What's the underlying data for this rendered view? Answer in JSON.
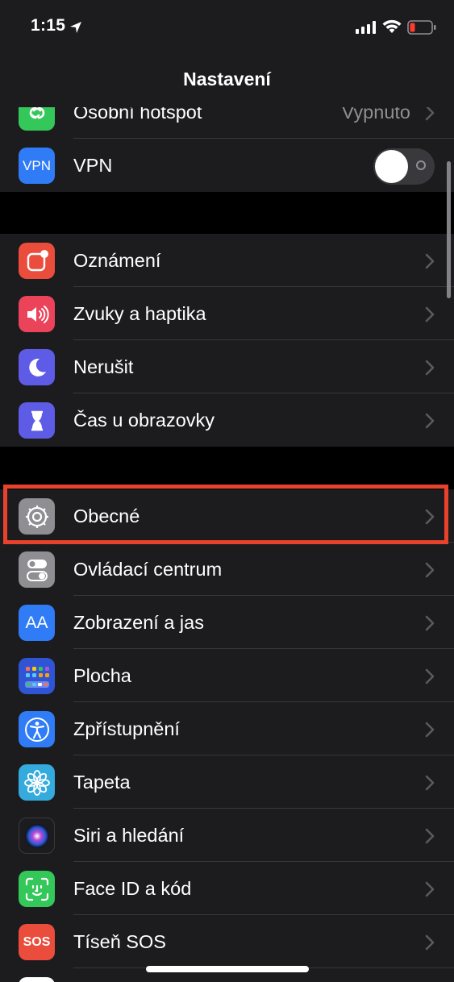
{
  "status_bar": {
    "time": "1:15"
  },
  "nav": {
    "title": "Nastavení"
  },
  "section1": [
    {
      "label": "Osobní hotspot",
      "value": "Vypnuto",
      "icon": "hotspot-icon",
      "color": "#34c759"
    },
    {
      "label": "VPN",
      "icon_text": "VPN",
      "icon": "vpn-icon",
      "color": "#2f7cf6",
      "toggle": false
    }
  ],
  "section2": [
    {
      "label": "Oznámení",
      "icon": "notifications-icon",
      "color": "#eb4d3d"
    },
    {
      "label": "Zvuky a haptika",
      "icon": "speaker-icon",
      "color": "#eb445a"
    },
    {
      "label": "Nerušit",
      "icon": "moon-icon",
      "color": "#5e5ce6"
    },
    {
      "label": "Čas u obrazovky",
      "icon": "hourglass-icon",
      "color": "#5e5ce6"
    }
  ],
  "section3": [
    {
      "label": "Obecné",
      "icon": "gear-icon",
      "color": "#8e8e93"
    },
    {
      "label": "Ovládací centrum",
      "icon": "switches-icon",
      "color": "#8e8e93"
    },
    {
      "label": "Zobrazení a jas",
      "icon_text": "AA",
      "icon": "display-icon",
      "color": "#2f7cf6"
    },
    {
      "label": "Plocha",
      "icon": "home-screen-icon",
      "color": "#2f55d4"
    },
    {
      "label": "Zpřístupnění",
      "icon": "accessibility-icon",
      "color": "#2f7cf6"
    },
    {
      "label": "Tapeta",
      "icon": "flower-icon",
      "color": "#35aadc"
    },
    {
      "label": "Siri a hledání",
      "icon": "siri-icon",
      "color": "#1c1c1e"
    },
    {
      "label": "Face ID a kód",
      "icon": "faceid-icon",
      "color": "#34c759"
    },
    {
      "label": "Tíseň SOS",
      "icon_text": "SOS",
      "icon": "sos-icon",
      "color": "#eb4d3d"
    }
  ],
  "colors": {
    "highlight": "#e8422c",
    "background": "#000000",
    "cell": "#1c1c1e"
  }
}
